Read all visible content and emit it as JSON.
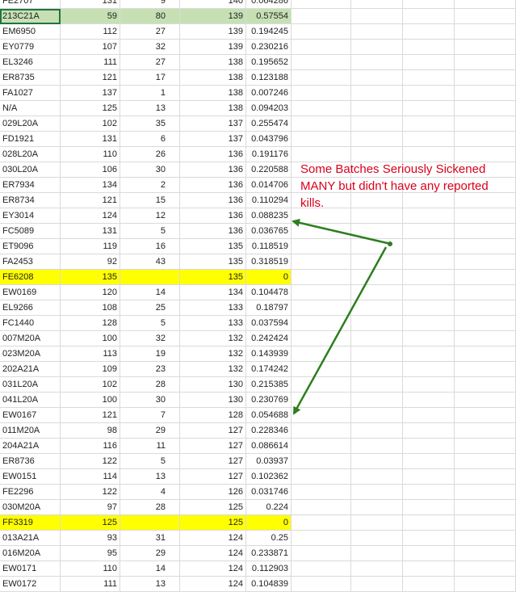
{
  "annotation": "Some Batches Seriously Sickened MANY but didn't have any reported kills.",
  "colors": {
    "highlight_yellow": "#ffff00",
    "highlight_green": "#c6e0b4",
    "arrow": "#2e7d1e",
    "annotation": "#d9001b"
  },
  "rows": [
    {
      "c": [
        "FE2707",
        "131",
        "9",
        "140",
        "0.064286"
      ]
    },
    {
      "c": [
        "213C21A",
        "59",
        "80",
        "139",
        "0.57554"
      ],
      "hl": "green",
      "selected": true
    },
    {
      "c": [
        "EM6950",
        "112",
        "27",
        "139",
        "0.194245"
      ]
    },
    {
      "c": [
        "EY0779",
        "107",
        "32",
        "139",
        "0.230216"
      ]
    },
    {
      "c": [
        "EL3246",
        "111",
        "27",
        "138",
        "0.195652"
      ]
    },
    {
      "c": [
        "ER8735",
        "121",
        "17",
        "138",
        "0.123188"
      ]
    },
    {
      "c": [
        "FA1027",
        "137",
        "1",
        "138",
        "0.007246"
      ]
    },
    {
      "c": [
        "N/A",
        "125",
        "13",
        "138",
        "0.094203"
      ]
    },
    {
      "c": [
        "029L20A",
        "102",
        "35",
        "137",
        "0.255474"
      ]
    },
    {
      "c": [
        "FD1921",
        "131",
        "6",
        "137",
        "0.043796"
      ]
    },
    {
      "c": [
        "028L20A",
        "110",
        "26",
        "136",
        "0.191176"
      ]
    },
    {
      "c": [
        "030L20A",
        "106",
        "30",
        "136",
        "0.220588"
      ]
    },
    {
      "c": [
        "ER7934",
        "134",
        "2",
        "136",
        "0.014706"
      ]
    },
    {
      "c": [
        "ER8734",
        "121",
        "15",
        "136",
        "0.110294"
      ]
    },
    {
      "c": [
        "EY3014",
        "124",
        "12",
        "136",
        "0.088235"
      ]
    },
    {
      "c": [
        "FC5089",
        "131",
        "5",
        "136",
        "0.036765"
      ]
    },
    {
      "c": [
        "ET9096",
        "119",
        "16",
        "135",
        "0.118519"
      ]
    },
    {
      "c": [
        "FA2453",
        "92",
        "43",
        "135",
        "0.318519"
      ]
    },
    {
      "c": [
        "FE6208",
        "135",
        "",
        "135",
        "0"
      ],
      "hl": "yellow"
    },
    {
      "c": [
        "EW0169",
        "120",
        "14",
        "134",
        "0.104478"
      ]
    },
    {
      "c": [
        "EL9266",
        "108",
        "25",
        "133",
        "0.18797"
      ]
    },
    {
      "c": [
        "FC1440",
        "128",
        "5",
        "133",
        "0.037594"
      ]
    },
    {
      "c": [
        "007M20A",
        "100",
        "32",
        "132",
        "0.242424"
      ]
    },
    {
      "c": [
        "023M20A",
        "113",
        "19",
        "132",
        "0.143939"
      ]
    },
    {
      "c": [
        "202A21A",
        "109",
        "23",
        "132",
        "0.174242"
      ]
    },
    {
      "c": [
        "031L20A",
        "102",
        "28",
        "130",
        "0.215385"
      ]
    },
    {
      "c": [
        "041L20A",
        "100",
        "30",
        "130",
        "0.230769"
      ]
    },
    {
      "c": [
        "EW0167",
        "121",
        "7",
        "128",
        "0.054688"
      ]
    },
    {
      "c": [
        "011M20A",
        "98",
        "29",
        "127",
        "0.228346"
      ]
    },
    {
      "c": [
        "204A21A",
        "116",
        "11",
        "127",
        "0.086614"
      ]
    },
    {
      "c": [
        "ER8736",
        "122",
        "5",
        "127",
        "0.03937"
      ]
    },
    {
      "c": [
        "EW0151",
        "114",
        "13",
        "127",
        "0.102362"
      ]
    },
    {
      "c": [
        "FE2296",
        "122",
        "4",
        "126",
        "0.031746"
      ]
    },
    {
      "c": [
        "030M20A",
        "97",
        "28",
        "125",
        "0.224"
      ]
    },
    {
      "c": [
        "FF3319",
        "125",
        "",
        "125",
        "0"
      ],
      "hl": "yellow"
    },
    {
      "c": [
        "013A21A",
        "93",
        "31",
        "124",
        "0.25"
      ]
    },
    {
      "c": [
        "016M20A",
        "95",
        "29",
        "124",
        "0.233871"
      ]
    },
    {
      "c": [
        "EW0171",
        "110",
        "14",
        "124",
        "0.112903"
      ]
    },
    {
      "c": [
        "EW0172",
        "111",
        "13",
        "124",
        "0.104839"
      ]
    }
  ]
}
